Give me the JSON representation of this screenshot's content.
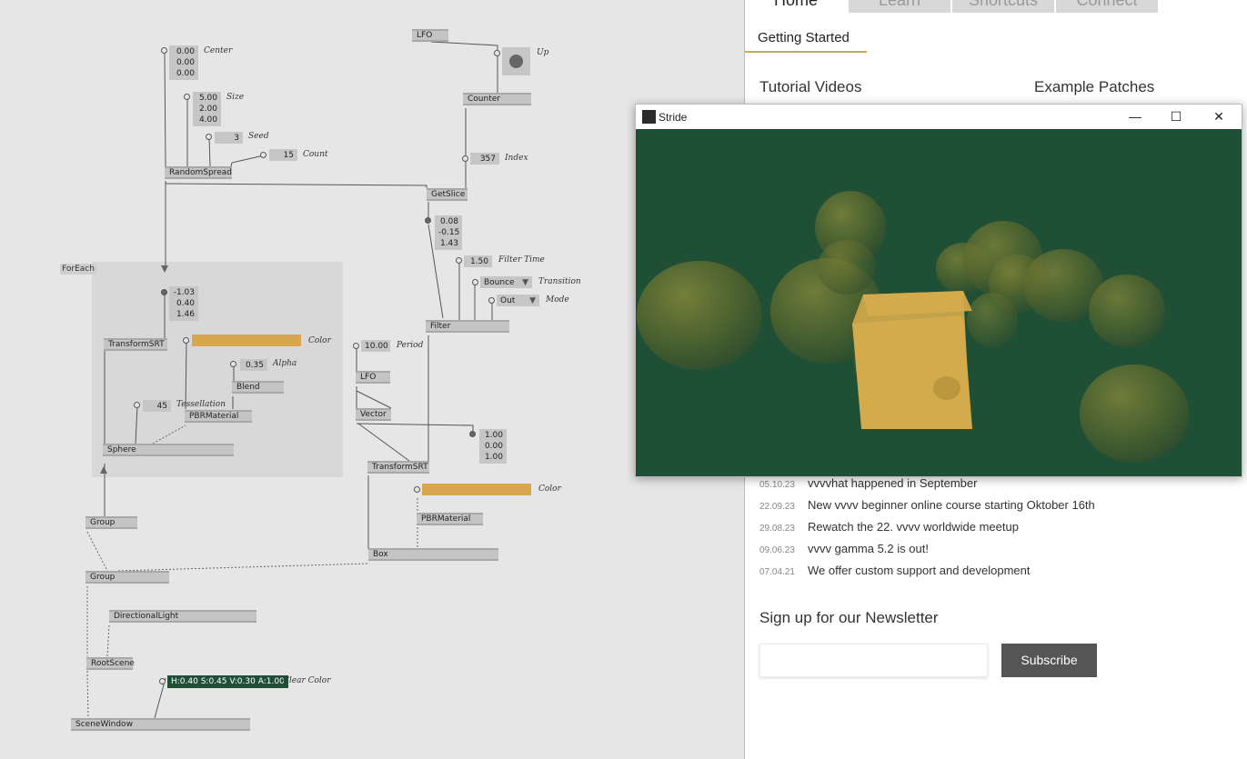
{
  "patch": {
    "region_label": "ForEach",
    "nodes": {
      "lfo_top": "LFO",
      "counter": "Counter",
      "random_spread": "RandomSpread",
      "get_slice": "GetSlice",
      "filter": "Filter",
      "transform_srt_inner": "TransformSRT",
      "blend": "Blend",
      "pbr_material_inner": "PBRMaterial",
      "sphere": "Sphere",
      "lfo_period": "LFO",
      "vector": "Vector",
      "transform_srt_outer": "TransformSRT",
      "pbr_material_outer": "PBRMaterial",
      "box": "Box",
      "group_1": "Group",
      "group_2": "Group",
      "directional_light": "DirectionalLight",
      "root_scene": "RootScene",
      "scene_window": "SceneWindow"
    },
    "iobox": {
      "center": "0.00\n0.00\n0.00",
      "size": "5.00\n2.00\n4.00",
      "seed": "3",
      "count": "15",
      "index": "357",
      "slice_out": "0.08\n-0.15\n1.43",
      "filter_time": "1.50",
      "transition": "Bounce",
      "mode": "Out",
      "foreach_vec": "-1.03\n0.40\n1.46",
      "alpha": "0.35",
      "tessellation": "45",
      "period": "10.00",
      "scale_vec": "1.00\n0.00\n1.00",
      "clear_color": "H:0.40 S:0.45 V:0.30 A:1.00"
    },
    "labels": {
      "center": "Center",
      "size": "Size",
      "seed": "Seed",
      "count": "Count",
      "up": "Up",
      "index": "Index",
      "filter_time": "Filter Time",
      "transition": "Transition",
      "mode": "Mode",
      "color_inner": "Color",
      "alpha": "Alpha",
      "tessellation": "Tessellation",
      "period": "Period",
      "color_outer": "Color",
      "clear_color": "Clear Color"
    },
    "colors": {
      "material": "#d9a650",
      "clear": "#1f4f35"
    }
  },
  "panel": {
    "tabs": [
      "Home",
      "Learn",
      "Shortcuts",
      "Connect"
    ],
    "subtab": "Getting Started",
    "tutorial_heading": "Tutorial Videos",
    "examples_heading": "Example Patches",
    "news": [
      {
        "date": "05.10.23",
        "text": "vvvvhat happened in September"
      },
      {
        "date": "22.09.23",
        "text": "New vvvv beginner online course starting Oktober 16th"
      },
      {
        "date": "29.08.23",
        "text": "Rewatch the 22. vvvv worldwide meetup"
      },
      {
        "date": "09.06.23",
        "text": "vvvv gamma 5.2 is out!"
      },
      {
        "date": "07.04.21",
        "text": "We offer custom support and development"
      }
    ],
    "newsletter_heading": "Sign up for our Newsletter",
    "newsletter_placeholder": "",
    "subscribe_label": "Subscribe"
  },
  "stride_window": {
    "title": "Stride",
    "minimize": "—",
    "maximize": "☐",
    "close": "✕",
    "background": "#1f4f35"
  }
}
